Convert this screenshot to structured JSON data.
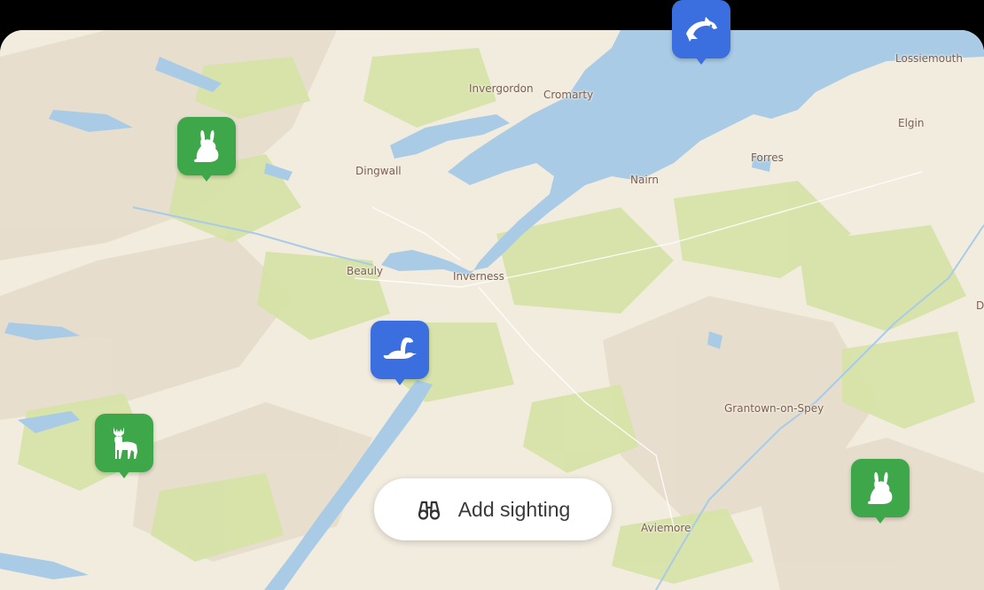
{
  "map": {
    "places": [
      {
        "name": "Invergordon"
      },
      {
        "name": "Cromarty"
      },
      {
        "name": "Lossiemouth"
      },
      {
        "name": "Elgin"
      },
      {
        "name": "Forres"
      },
      {
        "name": "Dingwall"
      },
      {
        "name": "Nairn"
      },
      {
        "name": "Beauly"
      },
      {
        "name": "Inverness"
      },
      {
        "name": "Grantown-on-Spey"
      },
      {
        "name": "Aviemore"
      },
      {
        "name": "D"
      }
    ],
    "markers": [
      {
        "animal": "dolphin",
        "icon": "dolphin-icon",
        "color": "#3b6fe0"
      },
      {
        "animal": "rabbit",
        "icon": "rabbit-icon",
        "color": "#3da74a"
      },
      {
        "animal": "loch-ness-monster",
        "icon": "nessie-icon",
        "color": "#3b6fe0"
      },
      {
        "animal": "deer",
        "icon": "deer-icon",
        "color": "#3da74a"
      },
      {
        "animal": "rabbit",
        "icon": "rabbit-icon",
        "color": "#3da74a"
      }
    ]
  },
  "actions": {
    "add_sighting_label": "Add sighting",
    "add_sighting_icon": "binoculars-icon"
  },
  "colors": {
    "water": "#a9cbe6",
    "land": "#f2ecdf",
    "vegetation": "#d5e3a5",
    "marker_blue": "#3b6fe0",
    "marker_green": "#3da74a"
  }
}
